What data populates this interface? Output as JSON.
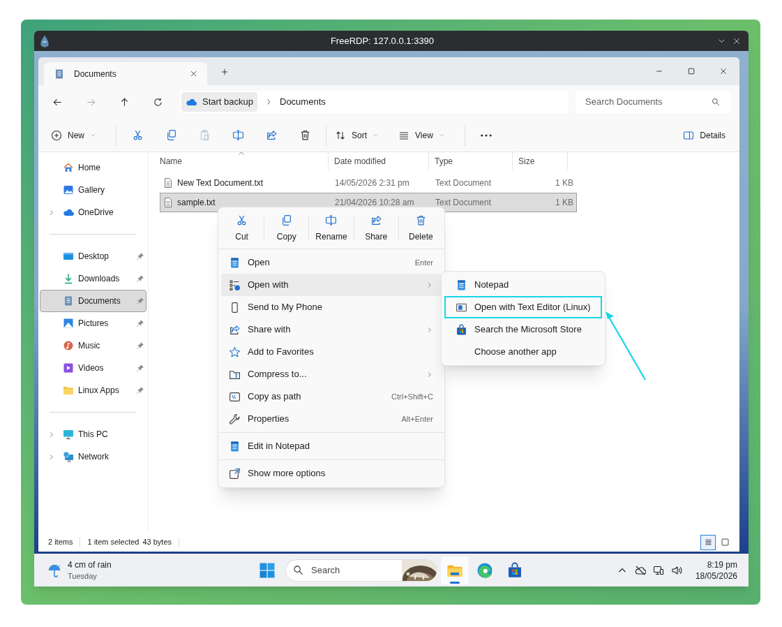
{
  "rdp_window": {
    "title": "FreeRDP: 127.0.0.1:3390"
  },
  "explorer": {
    "tabs": [
      {
        "label": "Documents",
        "selected": true
      }
    ],
    "breadcrumb": [
      "Start backup",
      "Documents"
    ],
    "search": {
      "placeholder": "Search Documents"
    },
    "toolbar": [
      {
        "kind": "new",
        "label": "New",
        "disabled": false
      },
      {
        "kind": "cut",
        "disabled": false
      },
      {
        "kind": "copy",
        "disabled": false
      },
      {
        "kind": "paste",
        "disabled": true
      },
      {
        "kind": "rename",
        "disabled": false
      },
      {
        "kind": "share",
        "disabled": false
      },
      {
        "kind": "delete",
        "disabled": false
      },
      {
        "kind": "sort",
        "label": "Sort",
        "disabled": false
      },
      {
        "kind": "view",
        "label": "View",
        "disabled": false
      },
      {
        "kind": "more",
        "disabled": false
      }
    ],
    "details_button": "Details",
    "sidebar": [
      [
        {
          "kind": "home",
          "label": "Home",
          "selected": false
        },
        {
          "kind": "gallery",
          "label": "Gallery",
          "selected": false
        },
        {
          "kind": "onedrive",
          "label": "OneDrive",
          "selected": false,
          "expanded": false
        }
      ],
      [
        {
          "kind": "desktop",
          "label": "Desktop",
          "selected": false,
          "pinned": true
        },
        {
          "kind": "downloads",
          "label": "Downloads",
          "selected": false,
          "pinned": true
        },
        {
          "kind": "documents",
          "label": "Documents",
          "selected": true,
          "pinned": true
        },
        {
          "kind": "pictures",
          "label": "Pictures",
          "selected": false,
          "pinned": true
        },
        {
          "kind": "music",
          "label": "Music",
          "selected": false,
          "pinned": true
        },
        {
          "kind": "videos",
          "label": "Videos",
          "selected": false,
          "pinned": true
        },
        {
          "kind": "folder",
          "label": "Linux Apps",
          "selected": false,
          "pinned": true
        }
      ],
      [
        {
          "kind": "thispc",
          "label": "This PC",
          "selected": false,
          "expanded": false
        },
        {
          "kind": "network",
          "label": "Network",
          "selected": false,
          "expanded": false
        }
      ]
    ],
    "columns": [
      {
        "label": "Name",
        "sorted": true
      },
      {
        "label": "Date modified",
        "sorted": false
      },
      {
        "label": "Type",
        "sorted": false
      },
      {
        "label": "Size",
        "sorted": false
      }
    ],
    "rows": [
      {
        "name": "New Text Document.txt",
        "date": "14/05/2026 2:31 pm",
        "type": "Text Document",
        "size": "1 KB",
        "selected": false
      },
      {
        "name": "sample.txt",
        "date": "21/04/2026 10:28 am",
        "type": "Text Document",
        "size": "1 KB",
        "selected": true
      }
    ],
    "status_bar": {
      "count": "2 items",
      "selection": "1 item selected",
      "size": "43 bytes",
      "views": [
        {
          "kind": "details",
          "selected": true
        },
        {
          "kind": "tiles",
          "selected": false
        }
      ]
    }
  },
  "context_menu": {
    "quick_actions": [
      {
        "kind": "cut",
        "label": "Cut"
      },
      {
        "kind": "copy",
        "label": "Copy"
      },
      {
        "kind": "rename",
        "label": "Rename"
      },
      {
        "kind": "share",
        "label": "Share"
      },
      {
        "kind": "delete",
        "label": "Delete"
      }
    ],
    "sections": [
      [
        {
          "kind": "open",
          "label": "Open",
          "shortcut": "Enter",
          "submenu": false,
          "selected": false
        },
        {
          "kind": "openwith",
          "label": "Open with",
          "submenu": true,
          "selected": true
        },
        {
          "kind": "phone",
          "label": "Send to My Phone",
          "submenu": false,
          "selected": false
        },
        {
          "kind": "sharewith",
          "label": "Share with",
          "submenu": true,
          "selected": false
        },
        {
          "kind": "favorite",
          "label": "Add to Favorites",
          "submenu": false,
          "selected": false
        },
        {
          "kind": "compress",
          "label": "Compress to...",
          "submenu": true,
          "selected": false
        },
        {
          "kind": "copypath",
          "label": "Copy as path",
          "shortcut": "Ctrl+Shift+C",
          "submenu": false,
          "selected": false
        },
        {
          "kind": "properties",
          "label": "Properties",
          "shortcut": "Alt+Enter",
          "submenu": false,
          "selected": false
        }
      ],
      [
        {
          "kind": "notepad",
          "label": "Edit in Notepad",
          "submenu": false,
          "selected": false
        }
      ],
      [
        {
          "kind": "moreoptions",
          "label": "Show more options",
          "submenu": false,
          "selected": false
        }
      ]
    ]
  },
  "open_with_menu": [
    {
      "kind": "notepad",
      "label": "Notepad",
      "highlighted": false
    },
    {
      "kind": "linuxeditor",
      "label": "Open with Text Editor (Linux)",
      "highlighted": true
    },
    {
      "kind": "store",
      "label": "Search the Microsoft Store",
      "highlighted": false
    },
    {
      "kind": "blank",
      "label": "Choose another app",
      "highlighted": false
    }
  ],
  "taskbar": {
    "weather": {
      "summary": "4 cm of rain",
      "day": "Tuesday"
    },
    "search": {
      "placeholder": "Search"
    },
    "apps": [
      {
        "kind": "explorer",
        "running": true
      },
      {
        "kind": "edge",
        "running": false
      },
      {
        "kind": "store",
        "running": false
      }
    ],
    "clock": {
      "time": "8:19 pm",
      "date": "18/05/2026"
    }
  }
}
